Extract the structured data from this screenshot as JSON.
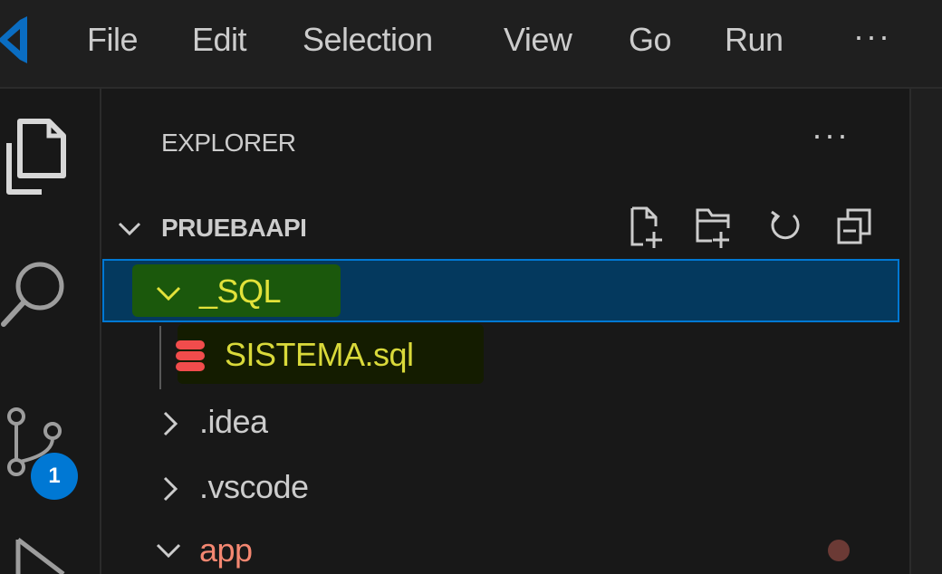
{
  "menu": {
    "file": "File",
    "edit": "Edit",
    "selection": "Selection",
    "view": "View",
    "go": "Go",
    "run": "Run",
    "more": "···"
  },
  "activity_bar": {
    "scm_badge": "1"
  },
  "explorer": {
    "title": "EXPLORER",
    "more": "···",
    "workspace": "PRUEBAAPI"
  },
  "tree": {
    "sql_folder": "_SQL",
    "sql_file": "SISTEMA.sql",
    "idea_folder": ".idea",
    "vscode_folder": ".vscode",
    "app_folder": "app"
  },
  "colors": {
    "selection_bg": "#04395e",
    "focus_border": "#0078d4",
    "highlight_text": "#e2e23a",
    "app_folder_text": "#f48771",
    "badge": "#0078d4"
  }
}
